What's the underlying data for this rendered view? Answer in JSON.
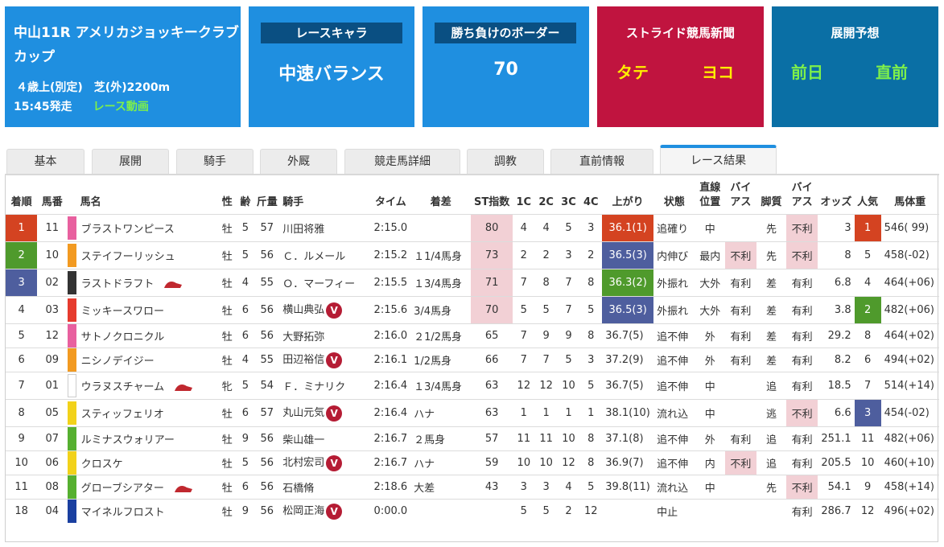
{
  "race": {
    "title": "中山11R アメリカジョッキークラブカップ",
    "condition": "４歳上(別定)　芝(外)2200m",
    "start": "15:45発走",
    "video": "レース動画"
  },
  "cards": {
    "chara_label": "レースキャラ",
    "chara_value": "中速バランス",
    "border_label": "勝ち負けのボーダー",
    "border_value": "70",
    "stride_label": "ストライド競馬新聞",
    "stride_tate": "タテ",
    "stride_yoko": "ヨコ",
    "tenkai_label": "展開予想",
    "tenkai_day_before": "前日",
    "tenkai_just_before": "直前"
  },
  "colors": {
    "brand_blue": "#1f8fe0",
    "dark_blue": "#0a6fa5",
    "crimson": "#c0143f",
    "rank1": "#d44321",
    "rank2": "#4f9a2c",
    "rank3": "#4e5e9e",
    "pink_cell": "#f2d0d5"
  },
  "tabs": [
    "基本",
    "展開",
    "騎手",
    "外厩",
    "競走馬詳細",
    "調教",
    "直前情報",
    "レース結果"
  ],
  "active_tab": "レース結果",
  "headers": {
    "rank": "着順",
    "num": "馬番",
    "name": "馬名",
    "sex": "性",
    "age": "齢",
    "weight": "斤量",
    "jockey": "騎手",
    "time": "タイム",
    "margin": "着差",
    "st": "ST指数",
    "c1": "1C",
    "c2": "2C",
    "c3": "3C",
    "c4": "4C",
    "agari": "上がり",
    "state": "状態",
    "straight1": "直線",
    "straight2": "位置",
    "bias1": "バイ",
    "bias2": "アス",
    "style": "脚質",
    "bias_b1": "バイ",
    "bias_b2": "アス",
    "odds": "オッズ",
    "pop": "人気",
    "body": "馬体重"
  },
  "rows": [
    {
      "rank": "1",
      "num": "11",
      "waku": "#e8609f",
      "name": "ブラストワンピース",
      "sex": "牡",
      "age": "5",
      "weight": "57",
      "jockey": "川田将雅",
      "mark": "",
      "time": "2:15.0",
      "margin": "",
      "st": "80",
      "c1": "4",
      "c2": "4",
      "c3": "5",
      "c4": "3",
      "agari": "36.1(1)",
      "state": "追確り",
      "pos": "中",
      "bias": "",
      "style": "先",
      "bias2": "不利",
      "odds": "3",
      "pop": "1",
      "body": "546( 99)",
      "icon": ""
    },
    {
      "rank": "2",
      "num": "10",
      "waku": "#f29a21",
      "name": "ステイフーリッシュ",
      "sex": "牡",
      "age": "5",
      "weight": "56",
      "jockey": "Ｃ．ルメール",
      "mark": "",
      "time": "2:15.2",
      "margin": "１1/4馬身",
      "st": "73",
      "c1": "2",
      "c2": "2",
      "c3": "3",
      "c4": "2",
      "agari": "36.5(3)",
      "state": "内伸び",
      "pos": "最内",
      "bias": "不利",
      "style": "先",
      "bias2": "不利",
      "odds": "8",
      "pop": "5",
      "body": "458(-02)",
      "icon": ""
    },
    {
      "rank": "3",
      "num": "02",
      "waku": "#333333",
      "name": "ラストドラフト",
      "sex": "牡",
      "age": "4",
      "weight": "55",
      "jockey": "Ｏ．マーフィー",
      "mark": "",
      "time": "2:15.5",
      "margin": "１3/4馬身",
      "st": "71",
      "c1": "7",
      "c2": "8",
      "c3": "7",
      "c4": "8",
      "agari": "36.3(2)",
      "state": "外振れ",
      "pos": "大外",
      "bias": "有利",
      "style": "差",
      "bias2": "有利",
      "odds": "6.8",
      "pop": "4",
      "body": "464(+06)",
      "icon": "hat"
    },
    {
      "rank": "4",
      "num": "03",
      "waku": "#e63b2e",
      "name": "ミッキースワロー",
      "sex": "牡",
      "age": "6",
      "weight": "56",
      "jockey": "横山典弘",
      "mark": "V",
      "time": "2:15.6",
      "margin": "3/4馬身",
      "st": "70",
      "c1": "5",
      "c2": "5",
      "c3": "7",
      "c4": "5",
      "agari": "36.5(3)",
      "state": "外振れ",
      "pos": "大外",
      "bias": "有利",
      "style": "差",
      "bias2": "有利",
      "odds": "3.8",
      "pop": "2",
      "body": "482(+06)",
      "icon": ""
    },
    {
      "rank": "5",
      "num": "12",
      "waku": "#e8609f",
      "name": "サトノクロニクル",
      "sex": "牡",
      "age": "6",
      "weight": "56",
      "jockey": "大野拓弥",
      "mark": "",
      "time": "2:16.0",
      "margin": "２1/2馬身",
      "st": "65",
      "c1": "7",
      "c2": "9",
      "c3": "9",
      "c4": "8",
      "agari": "36.7(5)",
      "state": "追不伸",
      "pos": "外",
      "bias": "有利",
      "style": "差",
      "bias2": "有利",
      "odds": "29.2",
      "pop": "8",
      "body": "464(+02)",
      "icon": ""
    },
    {
      "rank": "6",
      "num": "09",
      "waku": "#f29a21",
      "name": "ニシノデイジー",
      "sex": "牡",
      "age": "4",
      "weight": "55",
      "jockey": "田辺裕信",
      "mark": "V",
      "time": "2:16.1",
      "margin": "1/2馬身",
      "st": "66",
      "c1": "7",
      "c2": "7",
      "c3": "5",
      "c4": "3",
      "agari": "37.2(9)",
      "state": "追不伸",
      "pos": "外",
      "bias": "有利",
      "style": "差",
      "bias2": "有利",
      "odds": "8.2",
      "pop": "6",
      "body": "494(+02)",
      "icon": ""
    },
    {
      "rank": "7",
      "num": "01",
      "waku": "#ffffff",
      "name": "ウラヌスチャーム",
      "sex": "牝",
      "age": "5",
      "weight": "54",
      "jockey": "Ｆ．ミナリク",
      "mark": "",
      "time": "2:16.4",
      "margin": "１3/4馬身",
      "st": "63",
      "c1": "12",
      "c2": "12",
      "c3": "10",
      "c4": "5",
      "agari": "36.7(5)",
      "state": "追不伸",
      "pos": "中",
      "bias": "",
      "style": "追",
      "bias2": "有利",
      "odds": "18.5",
      "pop": "7",
      "body": "514(+14)",
      "icon": "hat"
    },
    {
      "rank": "8",
      "num": "05",
      "waku": "#f2d21a",
      "name": "スティッフェリオ",
      "sex": "牡",
      "age": "6",
      "weight": "57",
      "jockey": "丸山元気",
      "mark": "V",
      "time": "2:16.4",
      "margin": "ハナ",
      "st": "63",
      "c1": "1",
      "c2": "1",
      "c3": "1",
      "c4": "1",
      "agari": "38.1(10)",
      "state": "流れ込",
      "pos": "中",
      "bias": "",
      "style": "逃",
      "bias2": "不利",
      "odds": "6.6",
      "pop": "3",
      "body": "454(-02)",
      "icon": ""
    },
    {
      "rank": "9",
      "num": "07",
      "waku": "#56b030",
      "name": "ルミナスウォリアー",
      "sex": "牡",
      "age": "9",
      "weight": "56",
      "jockey": "柴山雄一",
      "mark": "",
      "time": "2:16.7",
      "margin": "２馬身",
      "st": "57",
      "c1": "11",
      "c2": "11",
      "c3": "10",
      "c4": "8",
      "agari": "37.1(8)",
      "state": "追不伸",
      "pos": "外",
      "bias": "有利",
      "style": "追",
      "bias2": "有利",
      "odds": "251.1",
      "pop": "11",
      "body": "482(+06)",
      "icon": ""
    },
    {
      "rank": "10",
      "num": "06",
      "waku": "#f2d21a",
      "name": "クロスケ",
      "sex": "牡",
      "age": "5",
      "weight": "56",
      "jockey": "北村宏司",
      "mark": "V",
      "time": "2:16.7",
      "margin": "ハナ",
      "st": "59",
      "c1": "10",
      "c2": "10",
      "c3": "12",
      "c4": "8",
      "agari": "36.9(7)",
      "state": "追不伸",
      "pos": "内",
      "bias": "不利",
      "style": "追",
      "bias2": "有利",
      "odds": "205.5",
      "pop": "10",
      "body": "460(+10)",
      "icon": ""
    },
    {
      "rank": "11",
      "num": "08",
      "waku": "#56b030",
      "name": "グローブシアター",
      "sex": "牡",
      "age": "6",
      "weight": "56",
      "jockey": "石橋脩",
      "mark": "",
      "time": "2:18.6",
      "margin": "大差",
      "st": "43",
      "c1": "3",
      "c2": "3",
      "c3": "4",
      "c4": "5",
      "agari": "39.8(11)",
      "state": "流れ込",
      "pos": "中",
      "bias": "",
      "style": "先",
      "bias2": "不利",
      "odds": "54.1",
      "pop": "9",
      "body": "458(+14)",
      "icon": "hat"
    },
    {
      "rank": "18",
      "num": "04",
      "waku": "#1a3fa0",
      "name": "マイネルフロスト",
      "sex": "牡",
      "age": "9",
      "weight": "56",
      "jockey": "松岡正海",
      "mark": "V",
      "time": "0:00.0",
      "margin": "",
      "st": "",
      "c1": "5",
      "c2": "5",
      "c3": "2",
      "c4": "12",
      "agari": "",
      "state": "中止",
      "pos": "",
      "bias": "",
      "style": "",
      "bias2": "有利",
      "odds": "286.7",
      "pop": "12",
      "body": "496(+02)",
      "icon": ""
    }
  ]
}
